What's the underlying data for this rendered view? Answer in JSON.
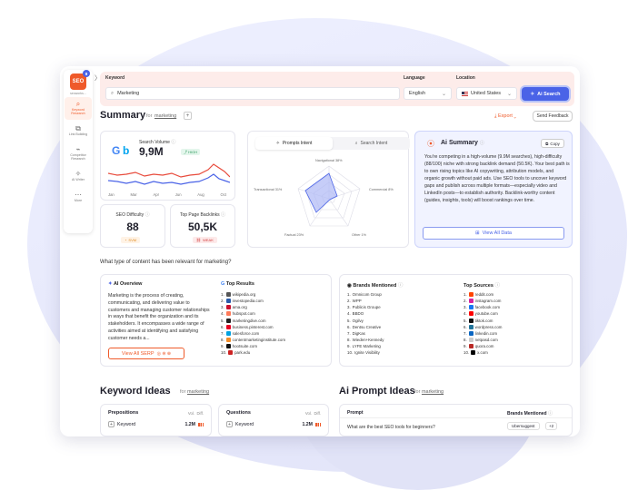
{
  "sidebar": {
    "logo_text": "SEO",
    "logo_badge": "8",
    "logo_label": "seoworks...",
    "items": [
      {
        "label": "Keyword Research",
        "icon": "⌕"
      },
      {
        "label": "Link Building",
        "icon": "⧉"
      },
      {
        "label": "Competitor Research",
        "icon": "⌁"
      },
      {
        "label": "AI Writer",
        "icon": "✧"
      },
      {
        "label": "More",
        "icon": "⋯"
      }
    ]
  },
  "search": {
    "keyword_label": "Keyword",
    "keyword_value": "Marketing",
    "language_label": "Language",
    "language_value": "English",
    "location_label": "Location",
    "location_value": "United States",
    "button_label": "Ai Search"
  },
  "summary": {
    "title": "Summary",
    "for_label": "for",
    "keyword": "marketing",
    "export_label": "Export",
    "send_feedback_label": "Send Feedback"
  },
  "volume": {
    "label": "Search Volume",
    "value": "9,9M",
    "badge": "HIGH",
    "months": [
      "Jan",
      "Mar",
      "Apr",
      "Jun",
      "Aug",
      "Oct"
    ]
  },
  "seo_difficulty": {
    "label": "SEO Difficulty",
    "value": "88",
    "badge": "SVM"
  },
  "backlinks": {
    "label": "Top Page Backlinks",
    "value": "50,5K",
    "badge": "WEAK"
  },
  "intent": {
    "tab_prompts": "Prompts Intent",
    "tab_search": "Search Intent",
    "labels": {
      "navigational": "Navigational 38%",
      "commercial": "Commercial 8%",
      "other": "Other 1%",
      "factual": "Factual 23%",
      "transactional": "Transactional 31%"
    }
  },
  "ai_summary": {
    "title": "Ai Summary",
    "copy_label": "Copy",
    "text": "You're competing in a high-volume (9.9M searches), high-difficulty (88/100) niche with strong backlink demand (50.5K). Your best path is to own rising topics like AI copywriting, attribution models, and organic growth without paid ads. Use SEO tools to uncover keyword gaps and publish across multiple formats—especially video and LinkedIn posts—to establish authority. Backlink-worthy content (guides, insights, tools) will boost rankings over time.",
    "view_all_label": "View All Data"
  },
  "content_question": "What type of content has been relevant for marketing?",
  "ai_overview": {
    "title": "AI Overview",
    "text": "Marketing is the process of creating, communicating, and delivering value to customers and managing customer relationships in ways that benefit the organization and its stakeholders. It encompasses a wide range of activities aimed at identifying and satisfying customer needs a...",
    "button_label": "View All SERP"
  },
  "top_results": {
    "title": "Top Results",
    "items": [
      "wikipedia.org",
      "investopedia.com",
      "ama.org",
      "hubspot.com",
      "marketingdive.com",
      "business.pinterest.com",
      "salesforce.com",
      "contentmarketinginstitute.com",
      "hootsuite.com",
      "park.edu"
    ]
  },
  "brands": {
    "title": "Brands Mentioned",
    "items": [
      "Omnicom Group",
      "WPP",
      "Publicis Groupe",
      "BBDO",
      "Ogilvy",
      "Dentsu Creative",
      "DigKas",
      "Wieden+Kennedy",
      "LYFE Marketing",
      "Ignite Visibility"
    ]
  },
  "top_sources": {
    "title": "Top Sources",
    "items": [
      "reddit.com",
      "instagram.com",
      "facebook.com",
      "youtube.com",
      "tiktok.com",
      "wordpress.com",
      "linkedin.com",
      "netpasd.com",
      "quora.com",
      "x.com"
    ]
  },
  "keyword_ideas": {
    "title": "Keyword Ideas",
    "for_label": "for",
    "keyword": "marketing",
    "prepositions": {
      "title": "Prepositions",
      "col_vol": "Vol.",
      "col_diff": "Diff.",
      "row_kw": "Keyword",
      "row_vol": "1.2M"
    },
    "questions": {
      "title": "Questions",
      "col_vol": "Vol.",
      "col_diff": "Diff.",
      "row_kw": "Keyword",
      "row_vol": "1.2M"
    }
  },
  "ai_prompt_ideas": {
    "title": "Ai Prompt Ideas",
    "for_label": "for",
    "keyword": "marketing",
    "col_prompt": "Prompt",
    "col_brands": "Brands Mentioned",
    "row_prompt": "What are the best SEO tools for beginners?",
    "row_brand": "Ubersuggest",
    "row_more": "+2"
  },
  "colors": {
    "accent": "#ef5a2a",
    "primary": "#4a63e7",
    "trend_red": "#e84b3c",
    "trend_blue": "#4a63e7"
  }
}
